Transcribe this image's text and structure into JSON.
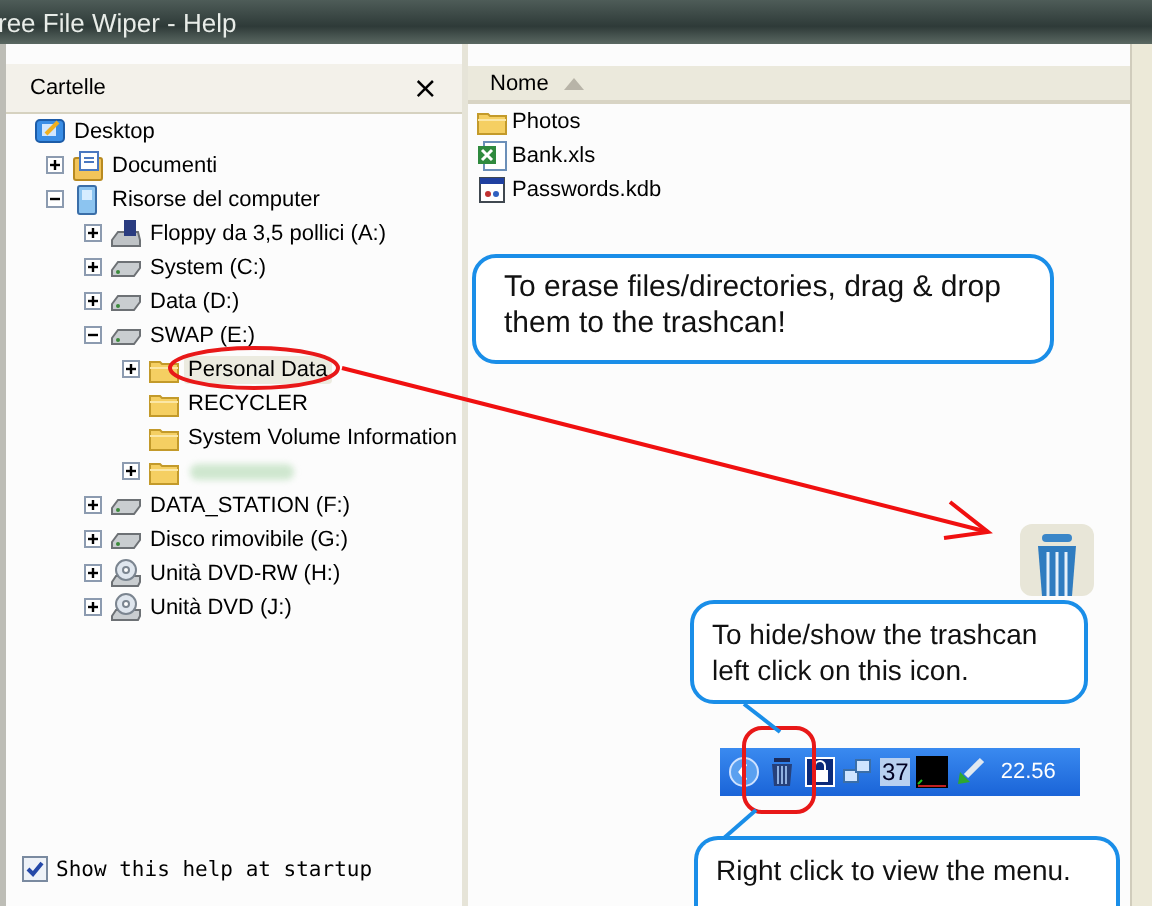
{
  "window": {
    "title": "ree File Wiper - Help"
  },
  "folders_panel": {
    "title": "Cartelle",
    "close": "×",
    "tree": [
      {
        "label": "Desktop",
        "kind": "desktop",
        "expandable": false,
        "selected": false,
        "children": [
          {
            "label": "Documenti",
            "kind": "documents",
            "expandable": true,
            "expanded": false,
            "selected": false
          },
          {
            "label": "Risorse del computer",
            "kind": "computer",
            "expandable": true,
            "expanded": true,
            "selected": false,
            "children": [
              {
                "label": "Floppy da 3,5 pollici (A:)",
                "kind": "floppy",
                "expandable": true,
                "expanded": false,
                "selected": false
              },
              {
                "label": "System (C:)",
                "kind": "drive",
                "expandable": true,
                "expanded": false,
                "selected": false
              },
              {
                "label": "Data (D:)",
                "kind": "drive",
                "expandable": true,
                "expanded": false,
                "selected": false
              },
              {
                "label": "SWAP (E:)",
                "kind": "drive",
                "expandable": true,
                "expanded": true,
                "selected": false,
                "children": [
                  {
                    "label": "Personal Data",
                    "kind": "folder",
                    "expandable": true,
                    "expanded": false,
                    "selected": true
                  },
                  {
                    "label": "RECYCLER",
                    "kind": "folder",
                    "expandable": false,
                    "selected": false
                  },
                  {
                    "label": "System Volume Information",
                    "kind": "folder",
                    "expandable": false,
                    "selected": false
                  },
                  {
                    "kind": "blurred",
                    "expandable": true,
                    "expanded": false
                  }
                ]
              },
              {
                "label": "DATA_STATION (F:)",
                "kind": "drive",
                "expandable": true,
                "expanded": false,
                "selected": false
              },
              {
                "label": "Disco rimovibile (G:)",
                "kind": "drive",
                "expandable": true,
                "expanded": false,
                "selected": false
              },
              {
                "label": "Unità DVD-RW (H:)",
                "kind": "cdrom",
                "expandable": true,
                "expanded": false,
                "selected": false
              },
              {
                "label": "Unità DVD (J:)",
                "kind": "cdrom",
                "expandable": true,
                "expanded": false,
                "selected": false
              }
            ]
          }
        ]
      }
    ]
  },
  "file_list": {
    "column": "Nome",
    "files": [
      {
        "name": "Photos",
        "kind": "folder"
      },
      {
        "name": "Bank.xls",
        "kind": "spreadsheet"
      },
      {
        "name": "Passwords.kdb",
        "kind": "app"
      }
    ]
  },
  "callouts": [
    {
      "text": "To erase files/directories, drag & drop them to the trashcan!"
    },
    {
      "text": "To hide/show the trashcan left click on this icon."
    },
    {
      "text": "Right click to view the menu."
    }
  ],
  "taskbar": {
    "items": [
      {
        "kind": "chevron"
      },
      {
        "kind": "trashcan"
      },
      {
        "kind": "lock"
      },
      {
        "kind": "network"
      },
      {
        "kind": "number",
        "label": "37"
      },
      {
        "kind": "black-square"
      },
      {
        "kind": "green-arrow"
      }
    ],
    "clock": "22.56"
  },
  "show_at_startup": {
    "label": "Show this help at startup",
    "checked": true
  }
}
